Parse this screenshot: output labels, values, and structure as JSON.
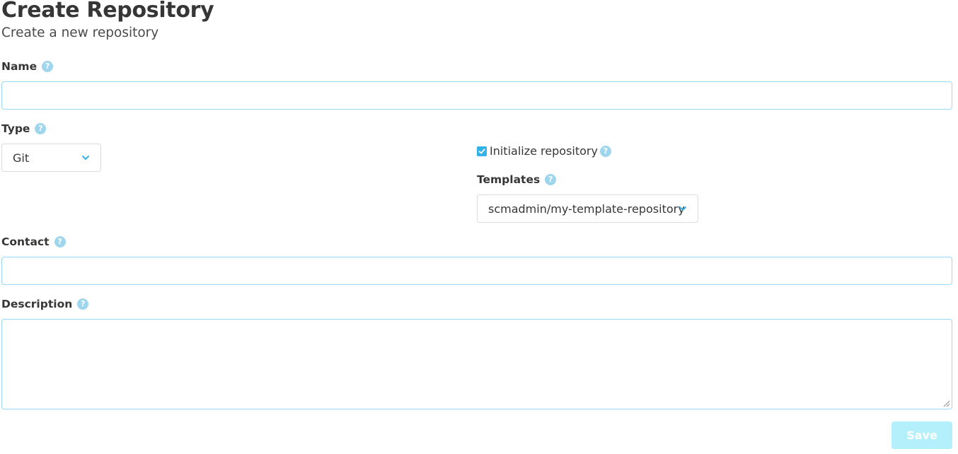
{
  "page": {
    "title": "Create Repository",
    "subtitle": "Create a new repository"
  },
  "form": {
    "name": {
      "label": "Name",
      "value": "",
      "help_icon": "question-circle-icon"
    },
    "type": {
      "label": "Type",
      "selected": "Git",
      "help_icon": "question-circle-icon"
    },
    "initialize": {
      "label": "Initialize repository",
      "checked": true
    },
    "templates": {
      "label": "Templates",
      "selected": "scmadmin/my-template-repository"
    },
    "contact": {
      "label": "Contact",
      "value": ""
    },
    "description": {
      "label": "Description",
      "value": ""
    },
    "save_label": "Save"
  },
  "colors": {
    "accent": "#33b2e8",
    "help_icon": "#9fd6ee",
    "input_border": "#98d8f3",
    "save_disabled": "#b4f0fb"
  }
}
